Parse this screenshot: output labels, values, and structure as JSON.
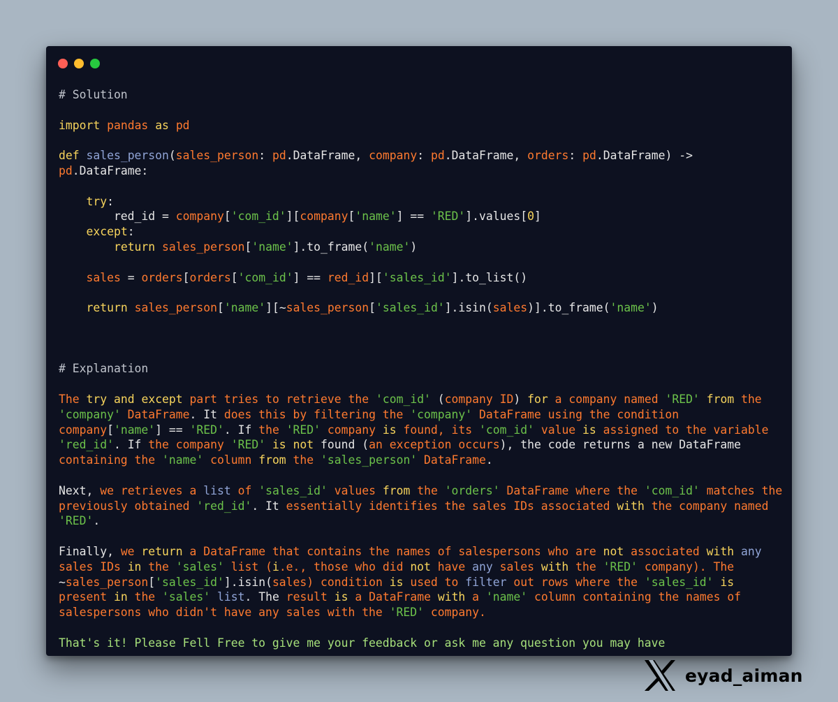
{
  "window": {
    "title_dots": [
      "close",
      "minimize",
      "maximize"
    ],
    "colors": {
      "close": "#ff5f56",
      "minimize": "#ffbd2e",
      "maximize": "#27c93f",
      "background": "#0d1120"
    }
  },
  "code": {
    "solution_comment": "# Solution",
    "import_line": [
      "import",
      " ",
      "pandas",
      " ",
      "as",
      " ",
      "pd"
    ],
    "def_line_1": [
      "def",
      " ",
      "sales_person",
      "(",
      "sales_person",
      ": ",
      "pd",
      ".DataFrame, ",
      "company",
      ": ",
      "pd",
      ".DataFrame, ",
      "orders",
      ": ",
      "pd",
      ".DataFrame) ->"
    ],
    "def_line_2": [
      "pd",
      ".DataFrame:"
    ],
    "try_line": [
      "    ",
      "try",
      ":"
    ],
    "red_id_line": [
      "        red_id = ",
      "company",
      "[",
      "'com_id'",
      "][",
      "company",
      "[",
      "'name'",
      "] == ",
      "'RED'",
      "].values[",
      "0",
      "]"
    ],
    "except_line": [
      "    ",
      "except",
      ":"
    ],
    "return1_line": [
      "        ",
      "return",
      " ",
      "sales_person",
      "[",
      "'name'",
      "].to_frame(",
      "'name'",
      ")"
    ],
    "sales_line": [
      "    ",
      "sales",
      " = ",
      "orders",
      "[",
      "orders",
      "[",
      "'com_id'",
      "] == ",
      "red_id",
      "][",
      "'sales_id'",
      "].to_list()"
    ],
    "return2_line": [
      "    ",
      "return",
      " ",
      "sales_person",
      "[",
      "'name'",
      "][~",
      "sales_person",
      "[",
      "'sales_id'",
      "].isin(",
      "sales",
      ")].to_frame(",
      "'name'",
      ")"
    ],
    "explanation_comment": "# Explanation",
    "para1": [
      [
        "The ",
        "try",
        " ",
        "and",
        " ",
        "except",
        " part tries to retrieve the ",
        "'com_id'",
        " (",
        "company ID",
        ") ",
        "for",
        " a company named ",
        "'RED'",
        " ",
        "from",
        " the"
      ],
      [
        "'company'",
        " DataFrame",
        ". It ",
        "does this by filtering the ",
        "'company'",
        " DataFrame using the condition"
      ],
      [
        "company",
        "[",
        "'name'",
        "] == ",
        "'RED'",
        ". If ",
        "the ",
        "'RED'",
        " company ",
        "is",
        " found, its ",
        "'com_id'",
        " value ",
        "is",
        " assigned to the variable"
      ],
      [
        "'red_id'",
        ". If ",
        "the company ",
        "'RED'",
        " ",
        "is",
        " ",
        "not",
        " found (",
        "an exception occurs",
        "), the code returns a new DataFrame"
      ],
      [
        "containing the ",
        "'name'",
        " column ",
        "from",
        " the ",
        "'sales_person'",
        " DataFrame",
        "."
      ]
    ],
    "para2": [
      [
        "Next, ",
        "we retrieves a ",
        "list",
        " of ",
        "'sales_id'",
        " values ",
        "from",
        " the ",
        "'orders'",
        " DataFrame where the ",
        "'com_id'",
        " matches the"
      ],
      [
        "previously obtained ",
        "'red_id'",
        ". It ",
        "essentially identifies the sales IDs associated ",
        "with",
        " the company named"
      ],
      [
        "'RED'",
        "."
      ]
    ],
    "para3": [
      [
        "Finally, ",
        "we ",
        "return",
        " a DataFrame that contains the names of salespersons who are ",
        "not",
        " associated ",
        "with",
        " ",
        "any"
      ],
      [
        "sales IDs ",
        "in",
        " the ",
        "'sales'",
        " list (",
        "i",
        ".e., those who did ",
        "not",
        " have ",
        "any",
        " sales ",
        "with",
        " the ",
        "'RED'",
        " company). The"
      ],
      [
        "~",
        "sales_person",
        "[",
        "'sales_id'",
        "].isin(",
        "sales",
        ") condition ",
        "is",
        " used to ",
        "filter",
        " out rows where the ",
        "'sales_id'",
        " ",
        "is"
      ],
      [
        "present ",
        "in",
        " the ",
        "'sales'",
        " ",
        "list",
        ". The ",
        "result ",
        "is",
        " a DataFrame ",
        "with",
        " a ",
        "'name'",
        " column containing the names of"
      ],
      [
        "salespersons who didn't have any sales with the ",
        "'RED'",
        " company."
      ]
    ],
    "closing": "That's it! Please Fell Free to give me your feedback or ask me any question you may have"
  },
  "branding": {
    "logo": "x-logo-icon",
    "handle": "eyad_aiman"
  }
}
